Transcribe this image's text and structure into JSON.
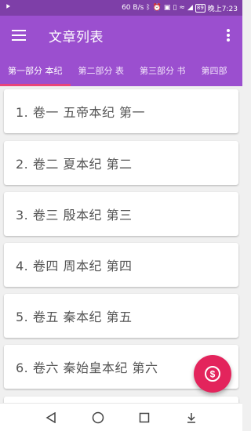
{
  "status_bar": {
    "left_icon": "android-icon",
    "speed": "60 B/s",
    "battery": "89",
    "time": "晚上7:23"
  },
  "toolbar": {
    "title": "文章列表",
    "menu_icon": "hamburger-menu-icon",
    "more_icon": "more-vert-icon"
  },
  "tabs": [
    {
      "label": "第一部分 本纪",
      "active": true
    },
    {
      "label": "第二部分 表",
      "active": false
    },
    {
      "label": "第三部分 书",
      "active": false
    },
    {
      "label": "第四部",
      "active": false
    }
  ],
  "articles": [
    {
      "label": "1. 卷一 五帝本纪 第一"
    },
    {
      "label": "2. 卷二 夏本纪 第二"
    },
    {
      "label": "3. 卷三 殷本纪 第三"
    },
    {
      "label": "4. 卷四 周本纪 第四"
    },
    {
      "label": "5. 卷五 秦本纪 第五"
    },
    {
      "label": "6. 卷六 秦始皇本纪 第六"
    }
  ],
  "fab": {
    "icon": "dollar-coin-icon",
    "color": "#e3245c"
  },
  "colors": {
    "primary": "#9b4fcf",
    "status_bar": "#7e3fa8",
    "tab_indicator": "#e8457a"
  }
}
